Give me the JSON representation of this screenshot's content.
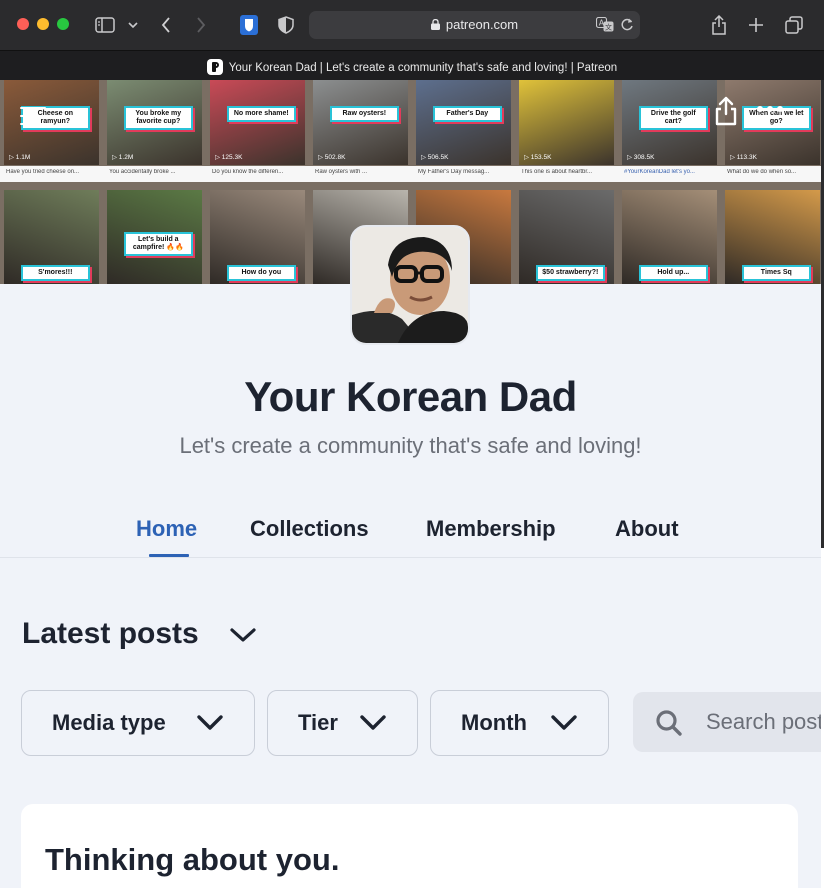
{
  "browser": {
    "url": "patreon.com",
    "tab_title": "Your Korean Dad | Let's create a community that's safe and loving! | Patreon"
  },
  "banner": {
    "row1": [
      {
        "caption": "Cheese on ramyun?",
        "stat": "▷ 1.1M",
        "desc": "Have you tried cheese on...",
        "color": "#8a5a3a"
      },
      {
        "caption": "You broke my favorite cup?",
        "stat": "▷ 1.2M",
        "desc": "You accidentally broke ...",
        "color": "#7b8c72"
      },
      {
        "caption": "No more shame!",
        "stat": "▷ 125.3K",
        "desc": "Do you know the differen...",
        "color": "#c94a57"
      },
      {
        "caption": "Raw oysters!",
        "stat": "▷ 502.8K",
        "desc": "Raw oysters with ...",
        "color": "#8c8f90"
      },
      {
        "caption": "Father's Day",
        "stat": "▷ 506.5K",
        "desc": "My Father's Day messag...",
        "color": "#5d6f8e"
      },
      {
        "caption": "",
        "stat": "▷ 153.5K",
        "desc": "This one is about heartbr...",
        "color": "#e0c23a"
      },
      {
        "caption": "Drive the golf cart?",
        "stat": "▷ 308.5K",
        "desc": "#YourKoreanDad let's yo...",
        "color": "#6f7880"
      },
      {
        "caption": "When can we let go?",
        "stat": "▷ 113.3K",
        "desc": "What do we do when so...",
        "color": "#8e7a6d"
      }
    ],
    "row2": [
      {
        "caption": "S'mores!!!",
        "color": "#6f7d5a"
      },
      {
        "caption": "Let's build a campfire! 🔥🔥",
        "color": "#5b7a45"
      },
      {
        "caption": "How do you",
        "color": "#9a8a7c"
      },
      {
        "caption": "",
        "color": "#b9b5ad"
      },
      {
        "caption": "",
        "color": "#c8793f"
      },
      {
        "caption": "$50 strawberry?!",
        "color": "#6b6b6b"
      },
      {
        "caption": "Hold up...",
        "color": "#a58f78"
      },
      {
        "caption": "Times Sq",
        "color": "#d49a4a"
      }
    ]
  },
  "profile": {
    "name": "Your Korean Dad",
    "tagline": "Let's create a community that's safe and loving!"
  },
  "nav": {
    "tabs": [
      "Home",
      "Collections",
      "Membership",
      "About"
    ],
    "active": "Home"
  },
  "posts": {
    "section_title": "Latest posts",
    "filters": [
      "Media type",
      "Tier",
      "Month"
    ],
    "search_placeholder": "Search posts",
    "first_post_title": "Thinking about you."
  },
  "colors": {
    "accent": "#2d62b5",
    "text": "#1d2330",
    "page_bg": "#f0f3f9"
  }
}
